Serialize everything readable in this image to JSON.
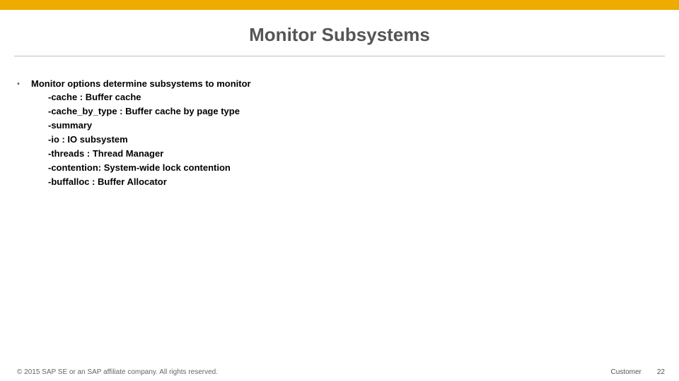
{
  "title": "Monitor Subsystems",
  "lead": "Monitor options determine subsystems to monitor",
  "options": [
    "-cache : Buffer cache",
    "-cache_by_type : Buffer cache by page type",
    "-summary",
    "-io : IO subsystem",
    "-threads : Thread Manager",
    "-contention: System-wide lock contention",
    "-buffalloc : Buffer Allocator"
  ],
  "footer": {
    "copyright": "© 2015 SAP SE or an SAP affiliate company. All rights reserved.",
    "audience": "Customer",
    "page": "22"
  }
}
